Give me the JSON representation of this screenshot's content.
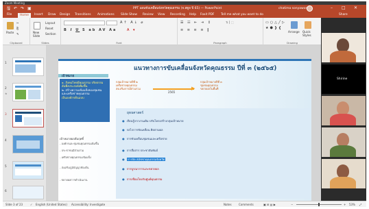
{
  "zoom_bar": {
    "title": "Zoom Meeting"
  },
  "titlebar": {
    "doc_title": "PPT แผนขับเคลื่อนจังหวัดคุณธรรม (จ.สตูล ปี 65) — PowerPoint",
    "user": "chatima sonyawong",
    "quick_access": [
      "save",
      "undo",
      "redo",
      "present"
    ]
  },
  "tabs": [
    "File",
    "Home",
    "Insert",
    "Draw",
    "Design",
    "Transitions",
    "Animations",
    "Slide Show",
    "Review",
    "View",
    "Recording",
    "Help",
    "Foxit PDF"
  ],
  "active_tab": "Home",
  "tell_me": "Tell me what you want to do",
  "share": "Share",
  "ribbon": {
    "groups": [
      "Clipboard",
      "Slides",
      "Font",
      "Paragraph",
      "Drawing"
    ],
    "clipboard": {
      "paste": "Paste"
    },
    "slides": {
      "new_slide": "New Slide",
      "layout": "Layout",
      "reset": "Reset",
      "section": "Section"
    },
    "drawing": {
      "arrange": "Arrange",
      "quick_styles": "Quick Styles"
    }
  },
  "slide_numbers": [
    "1",
    "2",
    "3",
    "4",
    "5",
    "6"
  ],
  "selected_slide": 3,
  "slide": {
    "title": "แนวทางการขับเคลื่อนจังหวัดคุณธรรม ปีที่ ๓ (๒๕๖๕)",
    "vision_label": "เป้าหมาย",
    "vision_lines": [
      "๑. สังคมไทยมีคุณธรรม จริยธรรม",
      "อันพึงประสงค์เพิ่มขึ้น",
      "๒. สร้างความเข้มแข็งของชุมชน",
      "และเครือข่ายคุณธรรม",
      "เป็นองค์กรต้นแบบ"
    ],
    "goal_head": "เป้าหมายผลสัมฤทธิ์",
    "goal_lines": [
      "- องค์กรและชุมชนคุณธรรมเพิ่มขึ้น",
      "- ประชาชนมีส่วนร่วม",
      "- เครือข่ายคุณธรรมเข้มแข็ง",
      "- ส่งเสริมภูมิปัญญาท้องถิ่น",
      "- ขยายผลการดำเนินงาน"
    ],
    "box_left": [
      "กลุ่มเป้าหมายปีที่ ๒",
      "เครือข่ายคุณธรรม",
      "ส่งเสริมการมีส่วนร่วม"
    ],
    "box_right": [
      "กลุ่มเป้าหมายปีที่ ๓",
      "ชุมชนคุณธรรม",
      "ขยายผลในพื้นที่"
    ],
    "year_label": "2565",
    "strategy_head": "ยุทธศาสตร์",
    "strategies": [
      "เรียนรู้จากงานเดิม ปรับโครงสร้างกลุ่มเป้าหมาย",
      "กลไกการขับเคลื่อน ติดตามผล",
      "การขับเคลื่อนชุมชนและเครือข่าย",
      "การสื่อสาร ประชาสัมพันธ์",
      "การจัด สมัชชาคุณธรรมจังหวัด",
      "การบูรณาการและขยายผล",
      "การเชื่อมโยงกับศูนย์คุณธรรม"
    ]
  },
  "participants": [
    {
      "name": "",
      "head": "#6b4a3a",
      "body": "#c06a3c"
    },
    {
      "name": "Shirine",
      "head": "#111111",
      "body": "#111111"
    },
    {
      "name": "",
      "head": "#c98d6e",
      "body": "#d8524f"
    },
    {
      "name": "",
      "head": "#b77e62",
      "body": "#5b7a3d"
    },
    {
      "name": "",
      "head": "#8d5b43",
      "body": "#e0a25a"
    }
  ],
  "status": {
    "slide_counter": "Slide 3 of 23",
    "language": "English (United States)",
    "accessibility": "Accessibility: Investigate",
    "notes": "Notes",
    "comments": "Comments",
    "zoom": "53%"
  },
  "colors": {
    "accent": "#b7472a",
    "slide_blue": "#2f6fb3",
    "title_navy": "#1f4e79"
  }
}
